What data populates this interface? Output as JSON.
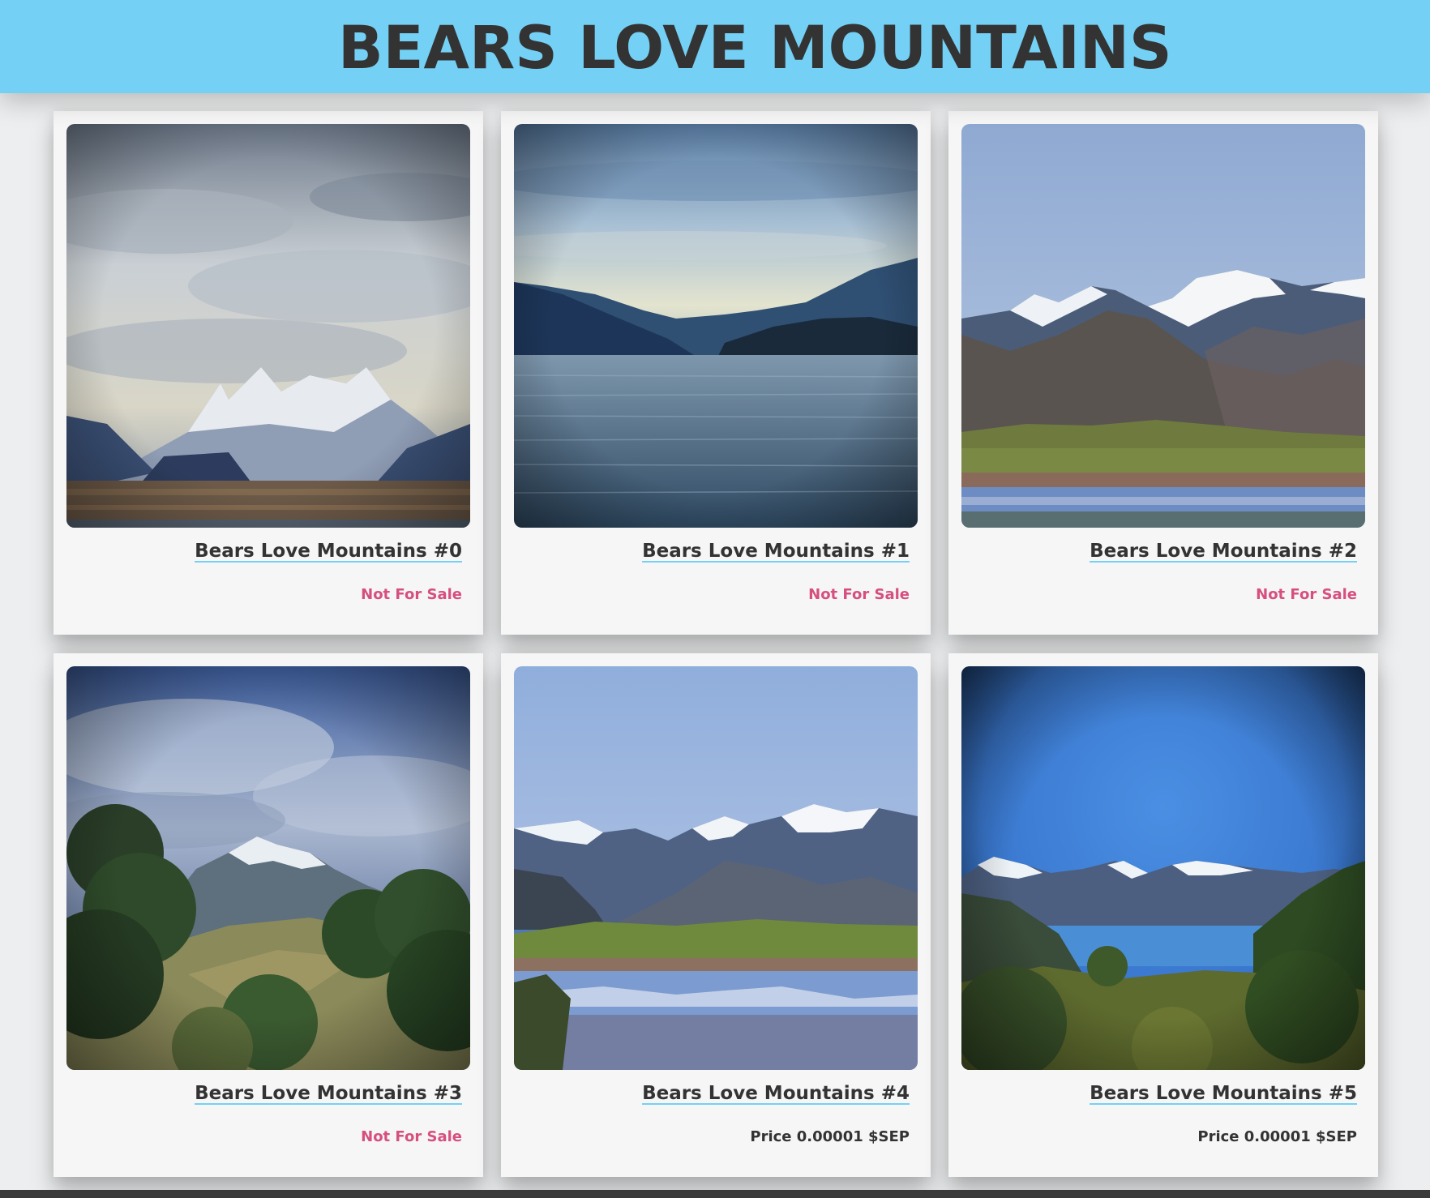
{
  "header": {
    "title": "BEARS LOVE MOUNTAINS"
  },
  "colors": {
    "header_bg": "#74d0f4",
    "not_for_sale": "#d64f7f",
    "title_text": "#333333"
  },
  "cards": [
    {
      "title": "Bears Love Mountains #0",
      "status": "Not For Sale",
      "image": "cloudy-snow-peak-photo"
    },
    {
      "title": "Bears Love Mountains #1",
      "status": "Not For Sale",
      "image": "lake-fjord-photo"
    },
    {
      "title": "Bears Love Mountains #2",
      "status": "Not For Sale",
      "image": "snowy-range-pond-photo"
    },
    {
      "title": "Bears Love Mountains #3",
      "status": "Not For Sale",
      "image": "forest-mountain-photo"
    },
    {
      "title": "Bears Love Mountains #4",
      "status": "Price 0.00001 $SEP",
      "image": "mountain-reflection-photo"
    },
    {
      "title": "Bears Love Mountains #5",
      "status": "Price 0.00001 $SEP",
      "image": "blue-sky-lake-photo"
    }
  ]
}
